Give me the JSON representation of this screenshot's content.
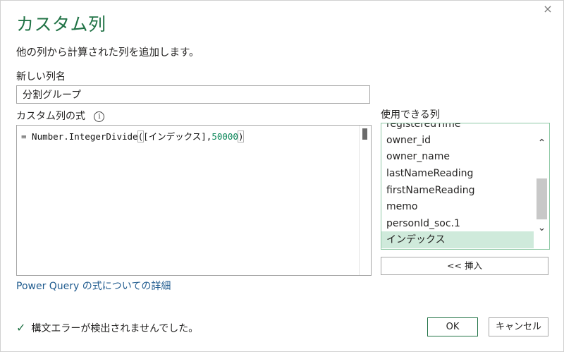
{
  "dialog": {
    "title": "カスタム列",
    "subtitle": "他の列から計算された列を追加します。",
    "close_icon": "×"
  },
  "new_column": {
    "label": "新しい列名",
    "value": "分割グループ"
  },
  "formula": {
    "label": "カスタム列の式",
    "info_icon": "i",
    "prefix": "= Number.IntegerDivide",
    "open_paren": "(",
    "argument": "[インデックス],",
    "number": "50000",
    "close_paren": ")"
  },
  "available_columns": {
    "label": "使用できる列",
    "items": [
      "registeredTime",
      "owner_id",
      "owner_name",
      "lastNameReading",
      "firstNameReading",
      "memo",
      "personId_soc.1",
      "インデックス"
    ],
    "selected": "インデックス",
    "scroll_up_icon": "⌃",
    "scroll_down_icon": "⌄"
  },
  "insert_button": "<< 挿入",
  "help_link": "Power Query の式についての詳細",
  "status": {
    "check_icon": "✓",
    "text": "構文エラーが検出されませんでした。"
  },
  "buttons": {
    "ok": "OK",
    "cancel": "キャンセル"
  },
  "colors": {
    "accent": "#217346",
    "selected_row": "#cfeadb",
    "link": "#1e5a8e",
    "number": "#098658"
  }
}
